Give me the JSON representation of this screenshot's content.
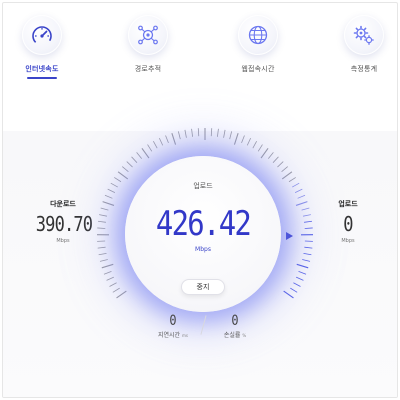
{
  "nav": {
    "items": [
      {
        "label": "인터넷속도",
        "icon": "speedometer-icon",
        "active": true
      },
      {
        "label": "경로추적",
        "icon": "route-icon",
        "active": false
      },
      {
        "label": "웹접속시간",
        "icon": "globe-icon",
        "active": false
      },
      {
        "label": "측정통계",
        "icon": "gear-stats-icon",
        "active": false
      }
    ]
  },
  "download": {
    "label": "다운로드",
    "value": "390.70",
    "unit": "Mbps"
  },
  "upload_side": {
    "label": "업로드",
    "value": "0",
    "unit": "Mbps"
  },
  "dial": {
    "title": "업로드",
    "value": "426.42",
    "unit": "Mbps",
    "stop_label": "중지"
  },
  "latency": {
    "value": "0",
    "label": "지연시간",
    "unit": "ms"
  },
  "loss": {
    "value": "0",
    "label": "손실률",
    "unit": "%"
  },
  "colors": {
    "accent": "#3a44c9",
    "glow": "#6c78f0"
  }
}
